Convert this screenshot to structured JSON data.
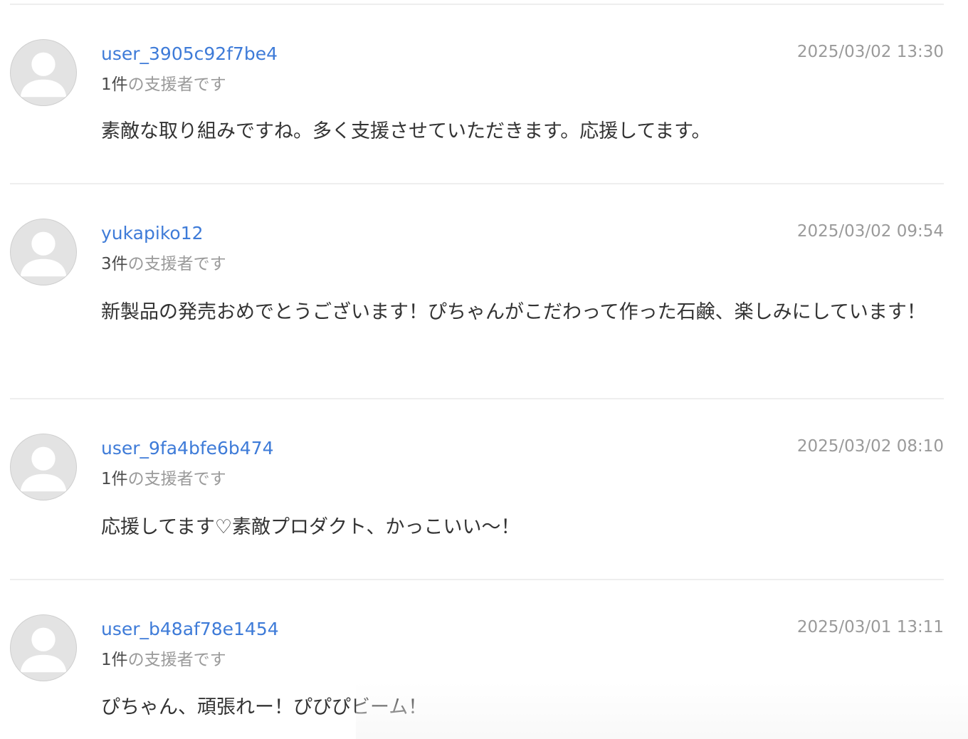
{
  "comments": [
    {
      "username": "user_3905c92f7be4",
      "timestamp": "2025/03/02 13:30",
      "support_count": "1件",
      "support_suffix": "の支援者です",
      "message": "素敵な取り組みですね。多く支援させていただきます。応援してます。"
    },
    {
      "username": "yukapiko12",
      "timestamp": "2025/03/02 09:54",
      "support_count": "3件",
      "support_suffix": "の支援者です",
      "message": "新製品の発売おめでとうございます！ぴちゃんがこだわって作った石鹸、楽しみにしています！"
    },
    {
      "username": "user_9fa4bfe6b474",
      "timestamp": "2025/03/02 08:10",
      "support_count": "1件",
      "support_suffix": "の支援者です",
      "message": "応援してます♡素敵プロダクト、かっこいい〜！"
    },
    {
      "username": "user_b48af78e1454",
      "timestamp": "2025/03/01 13:11",
      "support_count": "1件",
      "support_suffix": "の支援者です",
      "message": "ぴちゃん、頑張れー！ぴぴぴビーム！"
    }
  ]
}
